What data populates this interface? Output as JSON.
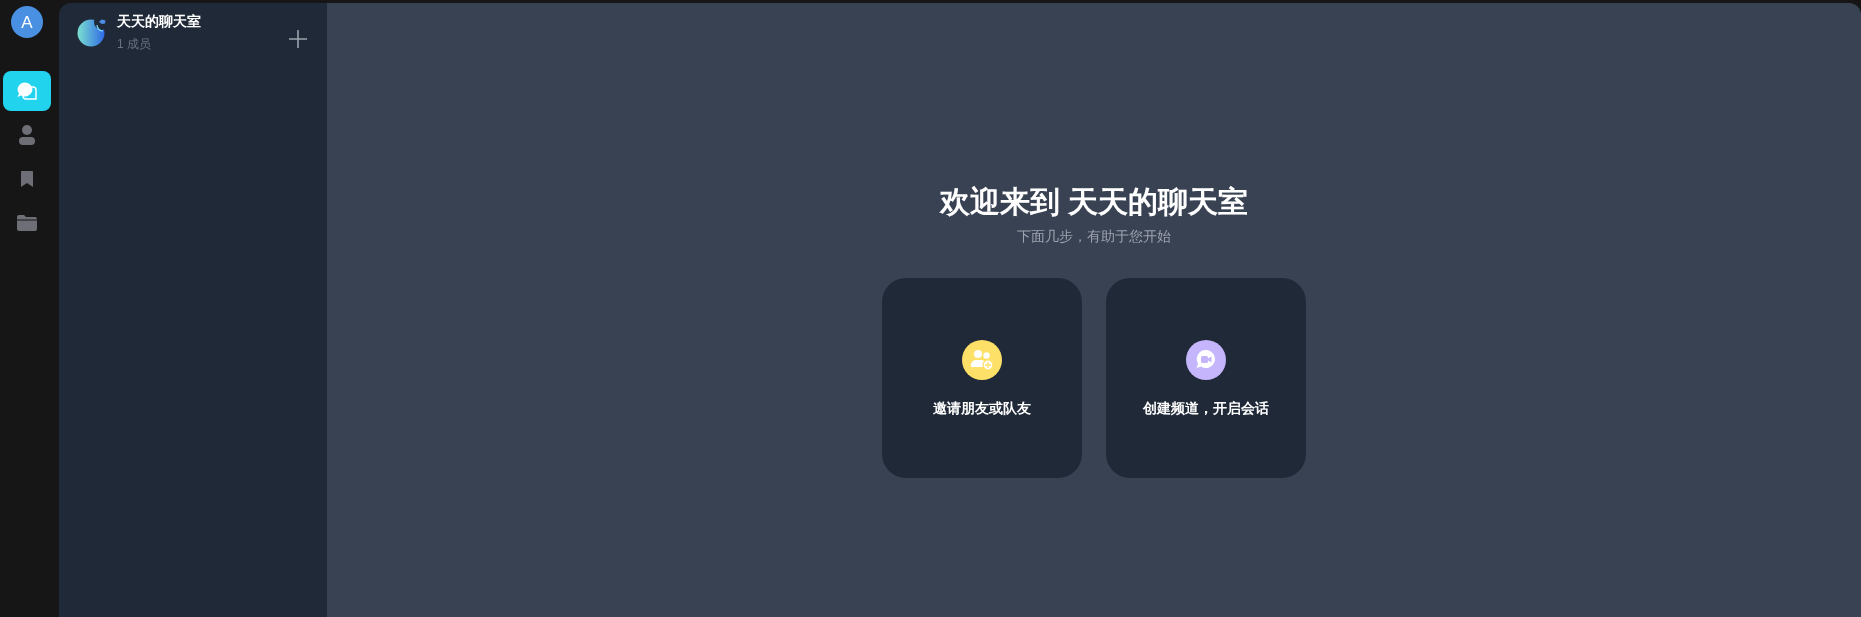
{
  "rail": {
    "avatar": "A",
    "nav": [
      {
        "kind": "chat",
        "selected": true
      },
      {
        "kind": "user",
        "selected": false
      },
      {
        "kind": "bookmark",
        "selected": false
      },
      {
        "kind": "folder",
        "selected": false
      }
    ]
  },
  "sidebar": {
    "room": {
      "name": "天天的聊天室",
      "members": "1 成员"
    }
  },
  "welcome": {
    "title": "欢迎来到 天天的聊天室",
    "subtitle": "下面几步，有助于您开始"
  },
  "actions": [
    {
      "kind": "invite",
      "label": "邀请朋友或队友",
      "color": "#fde068"
    },
    {
      "kind": "channel",
      "label": "创建频道，开启会话",
      "color": "#c4b5fd"
    }
  ]
}
